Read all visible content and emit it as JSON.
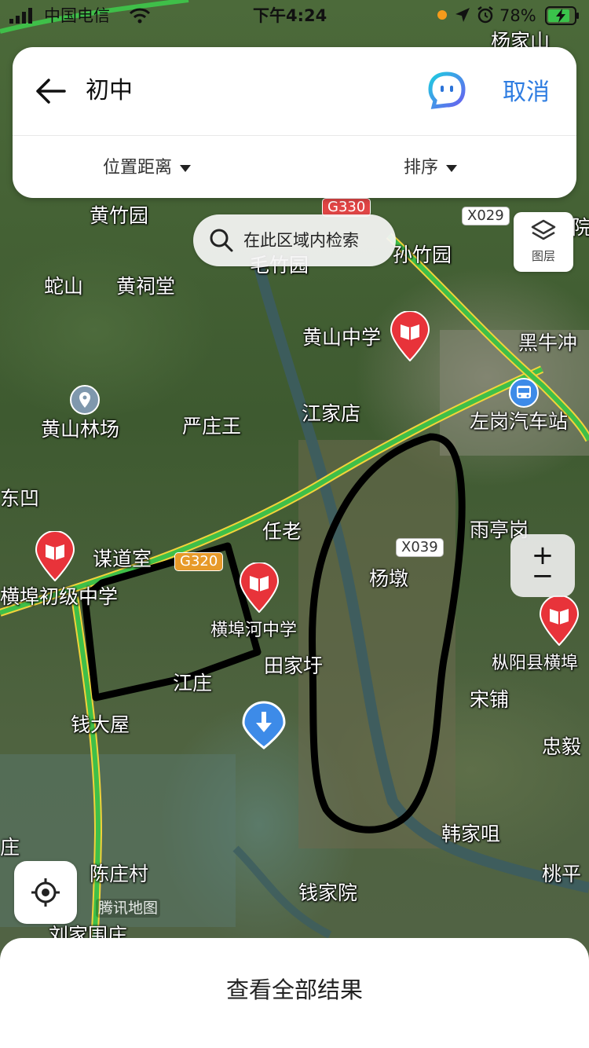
{
  "status_bar": {
    "carrier": "中国电信",
    "time": "下午4:24",
    "battery": "78%",
    "icons": [
      "signal-icon",
      "wifi-icon",
      "recording-dot-icon",
      "location-arrow-icon",
      "alarm-icon",
      "battery-charging-icon"
    ]
  },
  "search_card": {
    "back_icon": "arrow-left-icon",
    "query": "初中",
    "assistant_icon": "smart-assistant-icon",
    "cancel_label": "取消",
    "filters": [
      {
        "label": "位置距离"
      },
      {
        "label": "排序"
      }
    ]
  },
  "map": {
    "search_area_label": "在此区域内检索",
    "layer_label": "图层",
    "zoom_in": "+",
    "zoom_out": "−",
    "watermark": "腾讯地图",
    "roads": [
      {
        "label": "G330",
        "style": "red"
      },
      {
        "label": "X029",
        "style": "white"
      },
      {
        "label": "G320",
        "style": "orange"
      },
      {
        "label": "X039",
        "style": "white"
      }
    ],
    "places": [
      "杨家山",
      "黄竹园",
      "毛竹园",
      "孙竹园",
      "院",
      "蛇山",
      "黄祠堂",
      "黄山中学",
      "黑牛冲",
      "黄山林场",
      "严庄王",
      "江家店",
      "左岗汽车站",
      "东凹",
      "任老",
      "雨亭岗",
      "谋道室",
      "横埠初级中学",
      "杨墩",
      "横埠河中学",
      "枞阳县横埠",
      "田家圩",
      "江庄",
      "宋铺",
      "钱大屋",
      "忠毅",
      "韩家咀",
      "庄",
      "陈庄村",
      "桃平",
      "钱家院",
      "刘家围庄"
    ],
    "markers": [
      {
        "name": "黄山中学",
        "type": "school"
      },
      {
        "name": "横埠初级中学",
        "type": "school"
      },
      {
        "name": "横埠河中学",
        "type": "school"
      },
      {
        "name": "枞阳县横埠",
        "type": "school"
      },
      {
        "name": "黄山林场",
        "type": "poi"
      },
      {
        "name": "左岗汽车站",
        "type": "bus"
      }
    ]
  },
  "bottom_sheet": {
    "label": "查看全部结果"
  },
  "colors": {
    "accent": "#2f7de1",
    "school_marker": "#e8333a",
    "drawing": "#000000"
  }
}
